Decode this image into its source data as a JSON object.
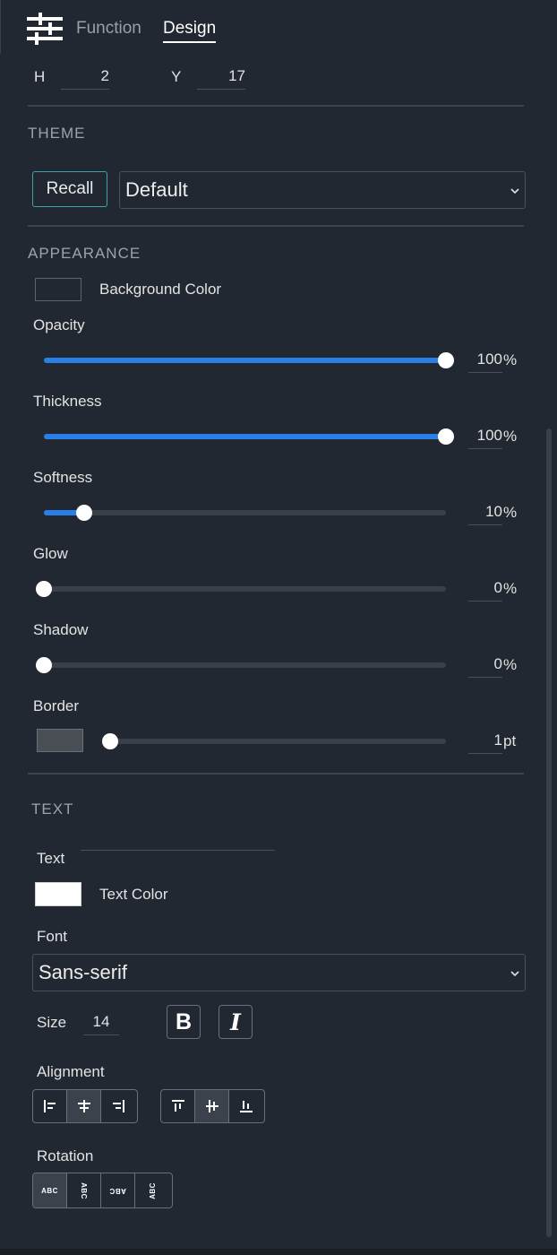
{
  "tabs": {
    "function_label": "Function",
    "design_label": "Design"
  },
  "position": {
    "h_label": "H",
    "h_value": "2",
    "y_label": "Y",
    "y_value": "17"
  },
  "theme": {
    "section_title": "THEME",
    "recall_label": "Recall",
    "selected": "Default"
  },
  "appearance": {
    "section_title": "APPEARANCE",
    "background_color_label": "Background Color",
    "background_color": "#222831",
    "opacity": {
      "label": "Opacity",
      "value": "100",
      "unit": "%",
      "fraction": 1.0
    },
    "thickness": {
      "label": "Thickness",
      "value": "100",
      "unit": "%",
      "fraction": 1.0
    },
    "softness": {
      "label": "Softness",
      "value": "10",
      "unit": "%",
      "fraction": 0.1
    },
    "glow": {
      "label": "Glow",
      "value": "0",
      "unit": "%",
      "fraction": 0.0
    },
    "shadow": {
      "label": "Shadow",
      "value": "0",
      "unit": "%",
      "fraction": 0.0
    },
    "border": {
      "label": "Border",
      "value": "1",
      "unit": "pt",
      "fraction": 0.0,
      "color": "#4a4e55"
    }
  },
  "text": {
    "section_title": "TEXT",
    "text_label": "Text",
    "text_value": "",
    "text_color_label": "Text Color",
    "text_color": "#ffffff",
    "font_label": "Font",
    "font_selected": "Sans-serif",
    "size_label": "Size",
    "size_value": "14",
    "bold_label": "B",
    "italic_label": "I",
    "alignment_label": "Alignment",
    "rotation_label": "Rotation",
    "rotation_options": [
      "ABC",
      "ABC",
      "ABC",
      "ABC"
    ]
  },
  "colors": {
    "accent": "#2a7fe6",
    "recall_border": "#3ea3a8",
    "background": "#222831"
  },
  "icons": [
    "sliders-icon",
    "chevron-down-icon",
    "align-left-icon",
    "align-center-icon",
    "align-right-icon",
    "align-top-icon",
    "align-middle-icon",
    "align-bottom-icon"
  ]
}
